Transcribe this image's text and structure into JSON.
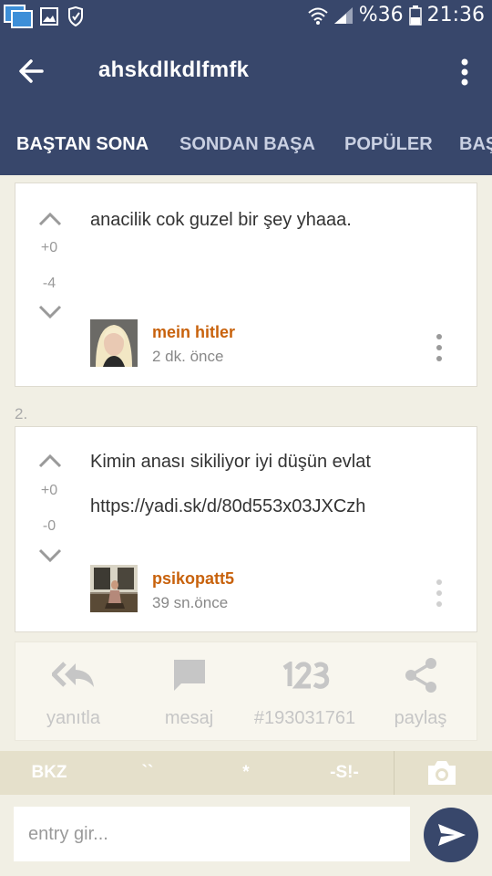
{
  "status_bar": {
    "battery_percent": "%36",
    "time": "21:36",
    "icons": [
      "multi-window-icon",
      "image-notification-icon",
      "app-notification-icon",
      "wifi-icon",
      "signal-icon",
      "battery-icon"
    ]
  },
  "header": {
    "title": "ahskdlkdlfmfk",
    "icons": [
      "back-arrow-icon",
      "more-vert-icon"
    ],
    "color": "#38476b"
  },
  "tabs": [
    {
      "label": "BAŞTAN SONA",
      "active": true
    },
    {
      "label": "SONDAN BAŞA",
      "active": false
    },
    {
      "label": "POPÜLER",
      "active": false
    },
    {
      "label": "BAŞ",
      "active": false
    }
  ],
  "entries": [
    {
      "text": "anacilik cok guzel bir şey yhaaa.",
      "link": "",
      "up_count": "+0",
      "down_count": "-4",
      "author": "mein hitler",
      "time_ago": "2 dk. önce"
    },
    {
      "number": "2.",
      "text": "Kimin anası sikiliyor iyi düşün evlat",
      "link": "https://yadi.sk/d/80d553x03JXCzh",
      "up_count": "+0",
      "down_count": "-0",
      "author": "psikopatt5",
      "time_ago": "39 sn.önce"
    }
  ],
  "actions": {
    "reply_label": "yanıtla",
    "message_label": "mesaj",
    "entry_id": "#193031761",
    "share_label": "paylaş",
    "icons": [
      "reply-all-icon",
      "message-icon",
      "numbers-123-icon",
      "share-icon"
    ]
  },
  "format_bar": {
    "bkz": "BKZ",
    "backtick": "``",
    "asterisk": "*",
    "spoiler": "-S!-",
    "icons": [
      "camera-icon"
    ]
  },
  "composer": {
    "placeholder": "entry gir...",
    "icons": [
      "send-icon"
    ]
  },
  "colors": {
    "primary": "#38476b",
    "author": "#c8620c",
    "background": "#f1efe4"
  }
}
